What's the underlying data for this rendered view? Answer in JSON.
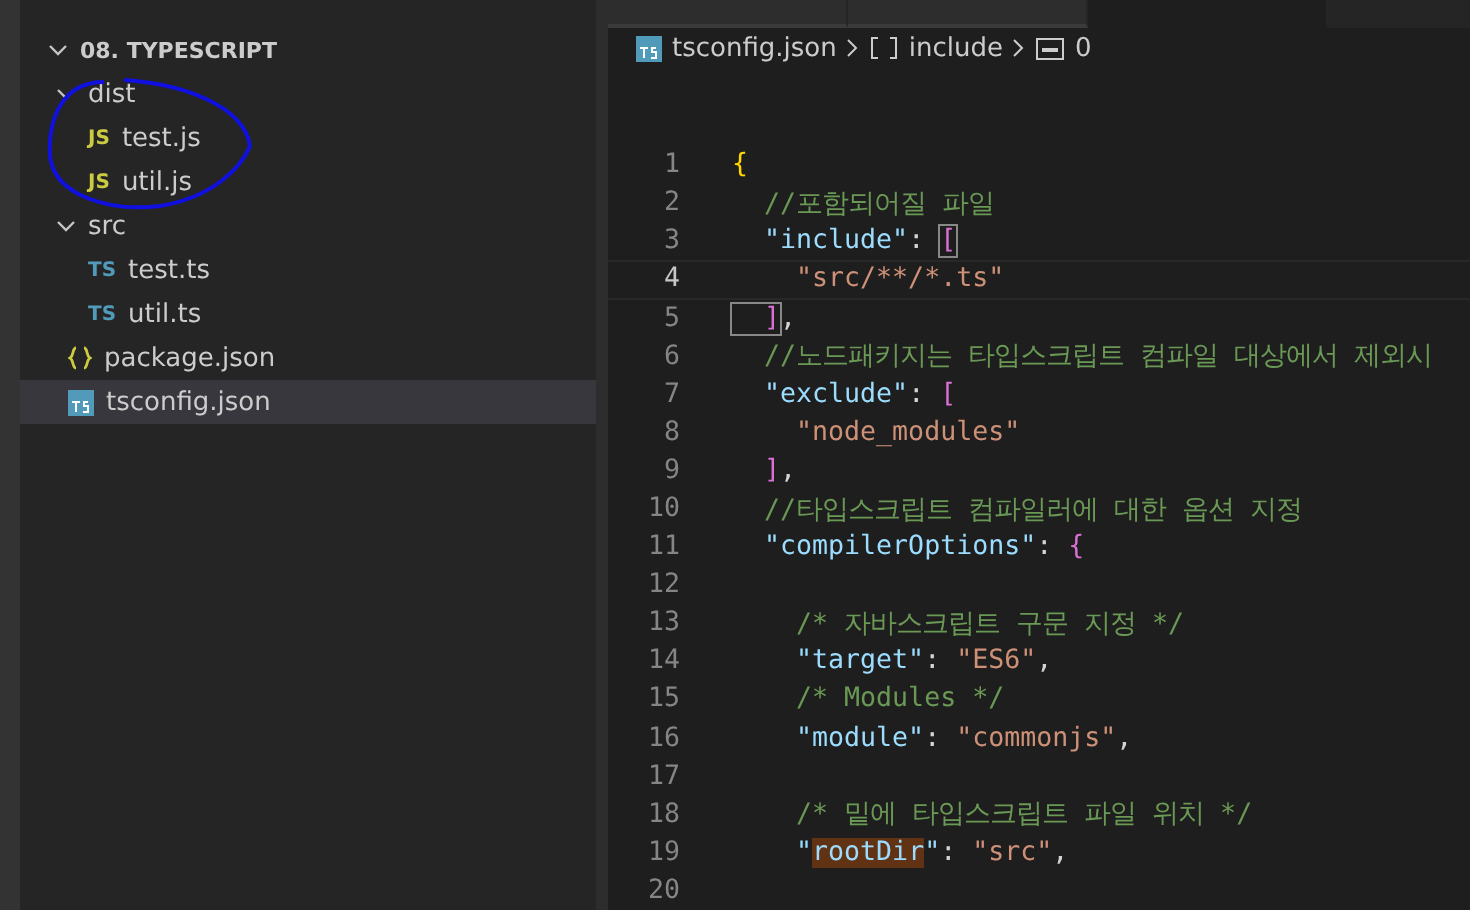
{
  "explorer": {
    "folder": {
      "label": "08. TYPESCRIPT",
      "expanded": true
    },
    "items": [
      {
        "kind": "folder",
        "label": "dist",
        "expanded": true,
        "circled": true,
        "children": [
          {
            "kind": "js",
            "badge": "JS",
            "label": "test.js",
            "selected": false
          },
          {
            "kind": "js",
            "badge": "JS",
            "label": "util.js",
            "selected": false
          }
        ]
      },
      {
        "kind": "folder",
        "label": "src",
        "expanded": true,
        "circled": false,
        "children": [
          {
            "kind": "ts",
            "badge": "TS",
            "label": "test.ts",
            "selected": false
          },
          {
            "kind": "ts",
            "badge": "TS",
            "label": "util.ts",
            "selected": false
          }
        ]
      },
      {
        "kind": "json",
        "label": "package.json",
        "selected": false
      },
      {
        "kind": "tsconfig",
        "label": "tsconfig.json",
        "selected": true
      }
    ]
  },
  "editor_tabs": [
    {
      "selected": false
    },
    {
      "selected": false
    },
    {
      "selected": true
    }
  ],
  "breadcrumb": [
    {
      "kind": "file",
      "label": "tsconfig.json"
    },
    {
      "kind": "array",
      "label": "include"
    },
    {
      "kind": "string",
      "label": "0"
    }
  ],
  "lines": [
    {
      "number": "1",
      "current": false,
      "tokens": [
        {
          "kind": "brace",
          "text": "{"
        }
      ]
    },
    {
      "number": "2",
      "current": false,
      "tokens": [
        {
          "kind": "comment",
          "text": "  //포함되어질 파일"
        }
      ]
    },
    {
      "number": "3",
      "current": false,
      "tokens": [
        {
          "kind": "key",
          "text": "  \"include\""
        },
        {
          "kind": "punct",
          "text": ": "
        },
        {
          "kind": "bracket-match",
          "text": "["
        }
      ]
    },
    {
      "number": "4",
      "current": true,
      "tokens": [
        {
          "kind": "string",
          "text": "    \"src/**/*.ts\""
        }
      ]
    },
    {
      "number": "5",
      "current": false,
      "tokens": [
        {
          "kind": "bracket-match",
          "text": "  ]"
        },
        {
          "kind": "punct",
          "text": ","
        }
      ]
    },
    {
      "number": "6",
      "current": false,
      "tokens": [
        {
          "kind": "comment",
          "text": "  //노드패키지는 타입스크립트 컴파일 대상에서 제외시"
        }
      ]
    },
    {
      "number": "7",
      "current": false,
      "tokens": [
        {
          "kind": "key",
          "text": "  \"exclude\""
        },
        {
          "kind": "punct",
          "text": ": "
        },
        {
          "kind": "bracket",
          "text": "["
        }
      ]
    },
    {
      "number": "8",
      "current": false,
      "tokens": [
        {
          "kind": "string",
          "text": "    \"node_modules\""
        }
      ]
    },
    {
      "number": "9",
      "current": false,
      "tokens": [
        {
          "kind": "bracket",
          "text": "  ]"
        },
        {
          "kind": "punct",
          "text": ","
        }
      ]
    },
    {
      "number": "10",
      "current": false,
      "tokens": [
        {
          "kind": "comment",
          "text": "  //타입스크립트 컴파일러에 대한 옵션 지정"
        }
      ]
    },
    {
      "number": "11",
      "current": false,
      "tokens": [
        {
          "kind": "key",
          "text": "  \"compilerOptions\""
        },
        {
          "kind": "punct",
          "text": ": "
        },
        {
          "kind": "bracket",
          "text": "{"
        }
      ]
    },
    {
      "number": "12",
      "current": false
    },
    {
      "number": "13",
      "current": false,
      "tokens": [
        {
          "kind": "comment",
          "text": "    /* 자바스크립트 구문 지정 */"
        }
      ]
    },
    {
      "number": "14",
      "current": false,
      "tokens": [
        {
          "kind": "key",
          "text": "    \"target\""
        },
        {
          "kind": "punct",
          "text": ": "
        },
        {
          "kind": "string",
          "text": "\"ES6\""
        },
        {
          "kind": "punct",
          "text": ","
        }
      ]
    },
    {
      "number": "15",
      "current": false,
      "tokens": [
        {
          "kind": "comment",
          "text": "    /* Modules */"
        }
      ]
    },
    {
      "number": "16",
      "current": false,
      "tokens": [
        {
          "kind": "key",
          "text": "    \"module\""
        },
        {
          "kind": "punct",
          "text": ": "
        },
        {
          "kind": "string",
          "text": "\"commonjs\""
        },
        {
          "kind": "punct",
          "text": ","
        }
      ]
    },
    {
      "number": "17",
      "current": false
    },
    {
      "number": "18",
      "current": false,
      "tokens": [
        {
          "kind": "comment",
          "text": "    /* 밑에 타입스크립트 파일 위치 */"
        }
      ]
    },
    {
      "number": "19",
      "current": false,
      "tokens": [
        {
          "kind": "key",
          "text": "    \""
        },
        {
          "kind": "match",
          "text": "rootDir"
        },
        {
          "kind": "key",
          "text": "\""
        },
        {
          "kind": "punct",
          "text": ": "
        },
        {
          "kind": "string",
          "text": "\"src\""
        },
        {
          "kind": "punct",
          "text": ","
        }
      ]
    },
    {
      "number": "20",
      "current": false
    }
  ]
}
